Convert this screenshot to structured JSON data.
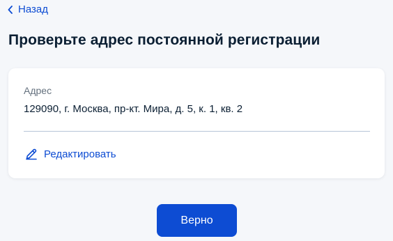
{
  "nav": {
    "back_label": "Назад"
  },
  "page": {
    "title": "Проверьте адрес постоянной регистрации"
  },
  "address_card": {
    "label": "Адрес",
    "value": "129090, г. Москва, пр-кт. Мира, д. 5, к. 1, кв. 2",
    "edit_label": "Редактировать"
  },
  "actions": {
    "confirm_label": "Верно"
  },
  "icons": {
    "back": "chevron-left-icon",
    "edit": "pencil-icon"
  },
  "colors": {
    "accent": "#0d4cd3",
    "background": "#f5f7fa",
    "text": "#0b1f33",
    "muted": "#66727f"
  }
}
